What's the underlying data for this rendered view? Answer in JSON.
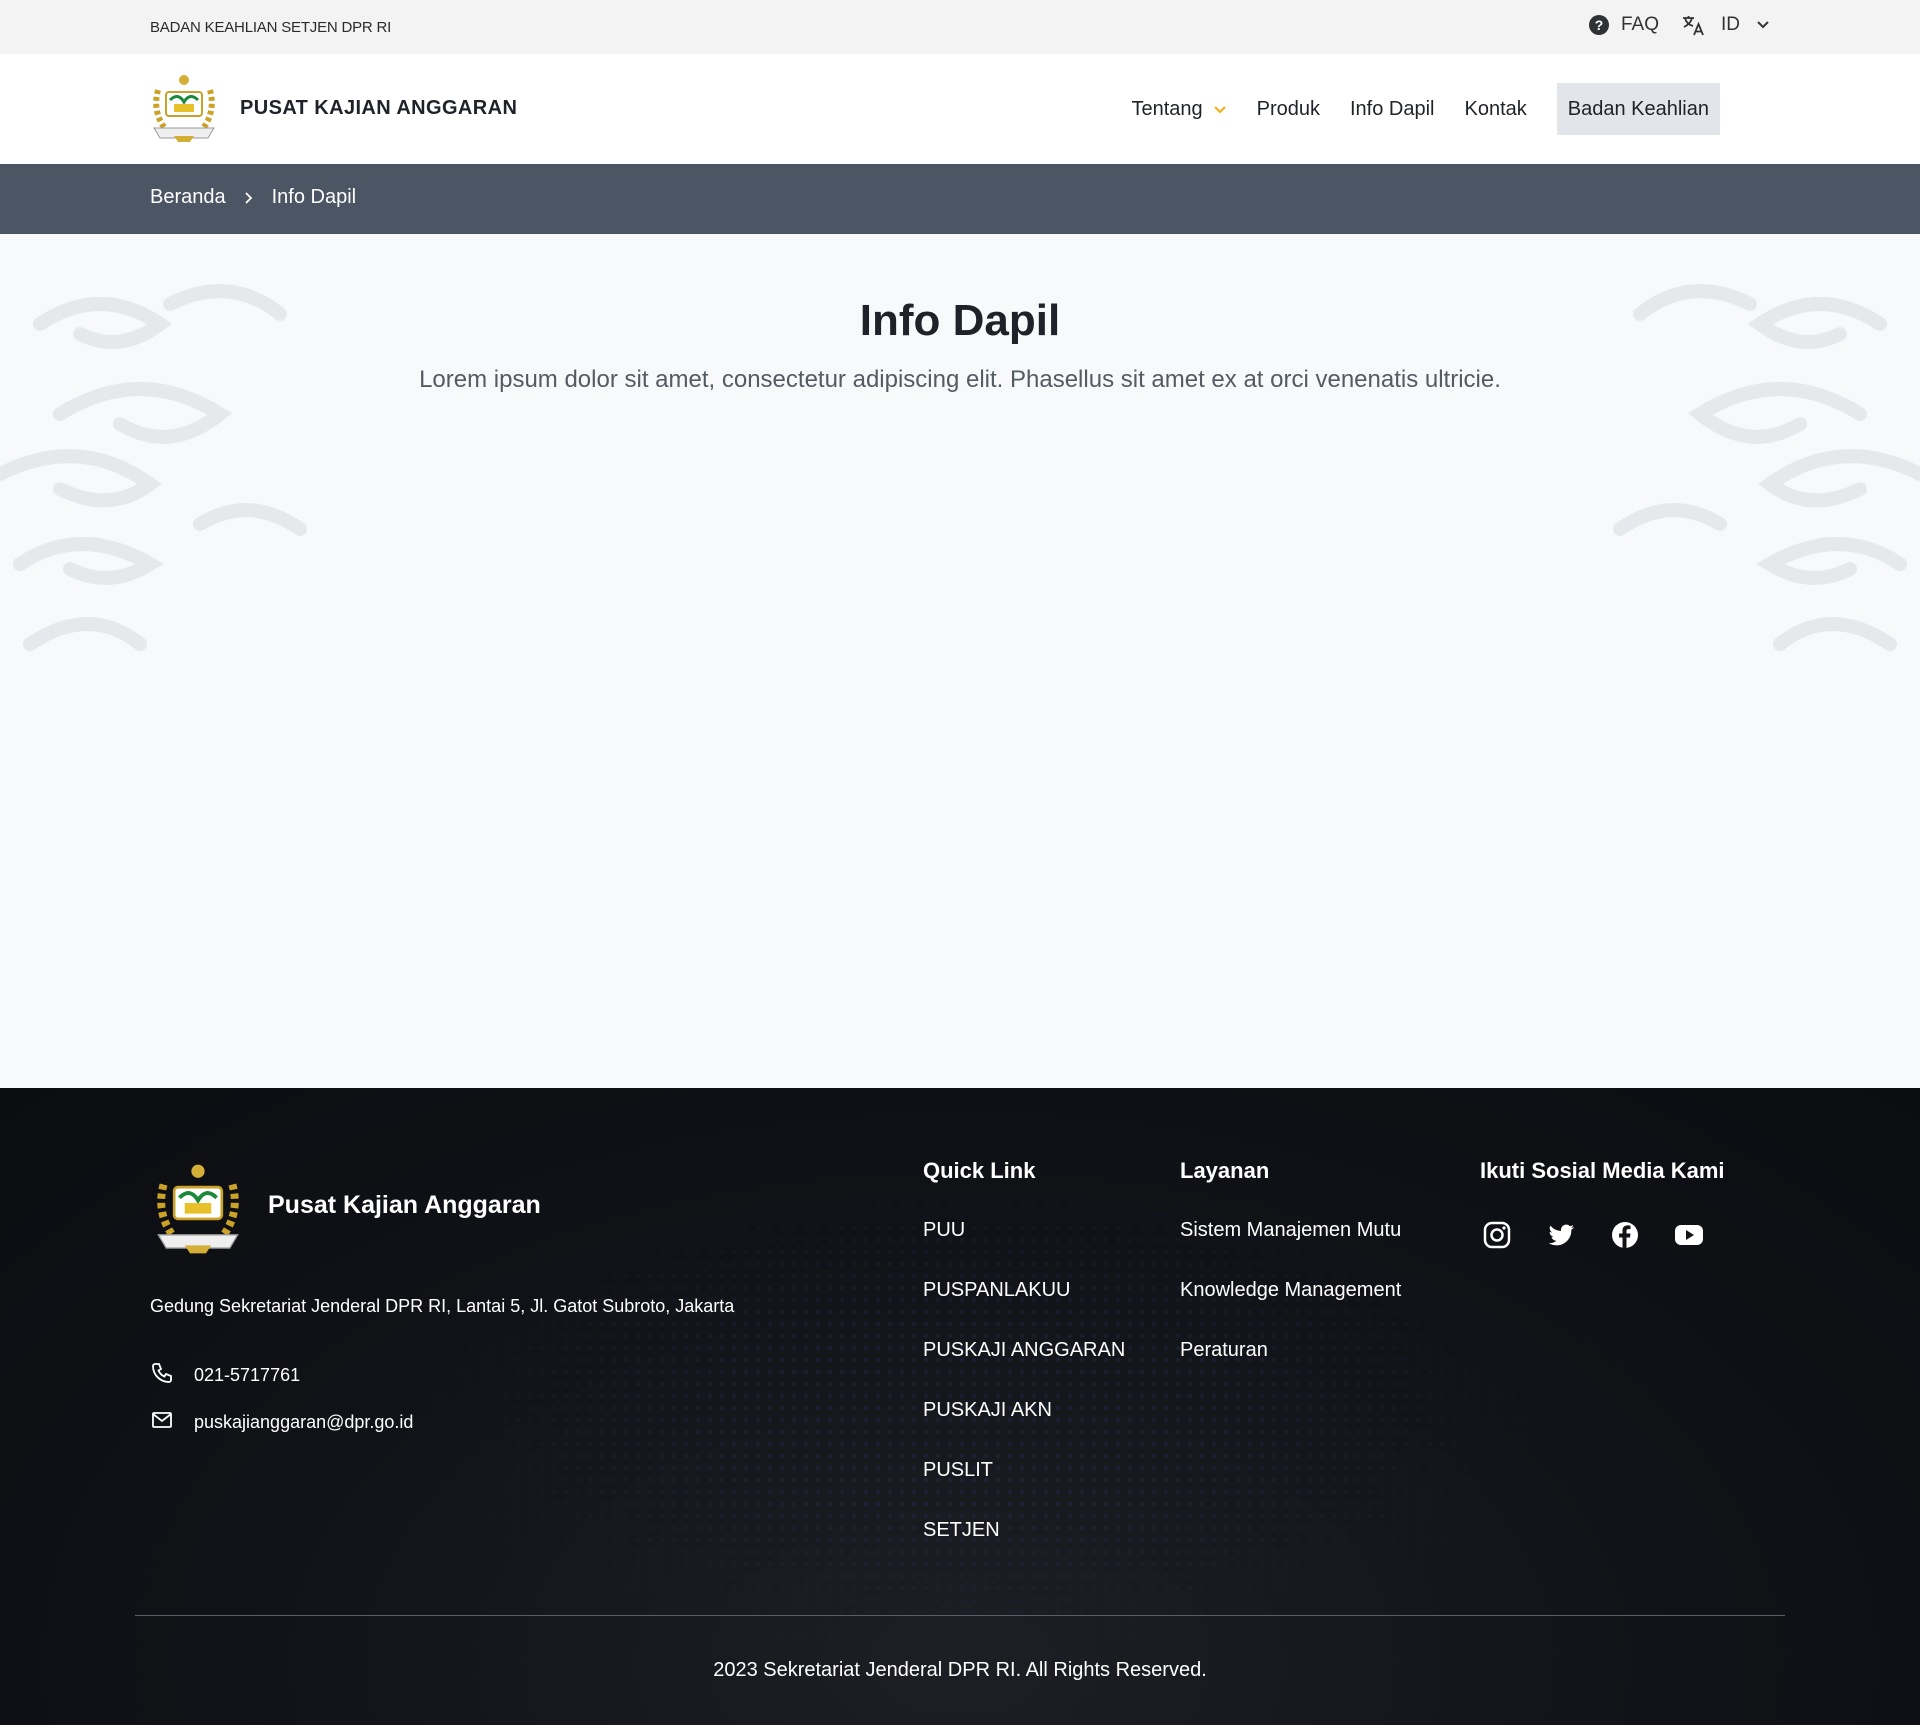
{
  "topbar": {
    "org_name": "BADAN KEAHLIAN SETJEN DPR RI",
    "faq_label": "FAQ",
    "language": "ID",
    "icons": [
      "help-circle-icon",
      "translate-icon",
      "chevron-down-icon"
    ]
  },
  "header": {
    "site_title": "PUSAT KAJIAN ANGGARAN",
    "nav": {
      "tentang": "Tentang",
      "produk": "Produk",
      "info_dapil": "Info Dapil",
      "kontak": "Kontak",
      "badan_keahlian": "Badan Keahlian"
    },
    "accent_color": "#f2b01e"
  },
  "breadcrumb": {
    "home": "Beranda",
    "current": "Info Dapil"
  },
  "hero": {
    "title": "Info Dapil",
    "subtitle": "Lorem ipsum dolor sit amet, consectetur adipiscing elit. Phasellus sit amet ex at orci venenatis ultricie."
  },
  "footer": {
    "org_name": "Pusat Kajian Anggaran",
    "address": "Gedung Sekretariat Jenderal DPR RI, Lantai 5, Jl. Gatot Subroto, Jakarta",
    "phone": "021-5717761",
    "email": "puskajianggaran@dpr.go.id",
    "quick_link": {
      "heading": "Quick Link",
      "items": [
        "PUU",
        "PUSPANLAKUU",
        "PUSKAJI ANGGARAN",
        "PUSKAJI AKN",
        "PUSLIT",
        "SETJEN"
      ]
    },
    "layanan": {
      "heading": "Layanan",
      "items": [
        "Sistem Manajemen Mutu",
        "Knowledge Management",
        "Peraturan"
      ]
    },
    "social": {
      "heading": "Ikuti Sosial Media Kami",
      "icons": [
        "instagram-icon",
        "twitter-icon",
        "facebook-icon",
        "youtube-icon"
      ]
    },
    "copyright": "2023 Sekretariat Jenderal DPR RI. All Rights Reserved.",
    "background_color": "#0f1116"
  }
}
